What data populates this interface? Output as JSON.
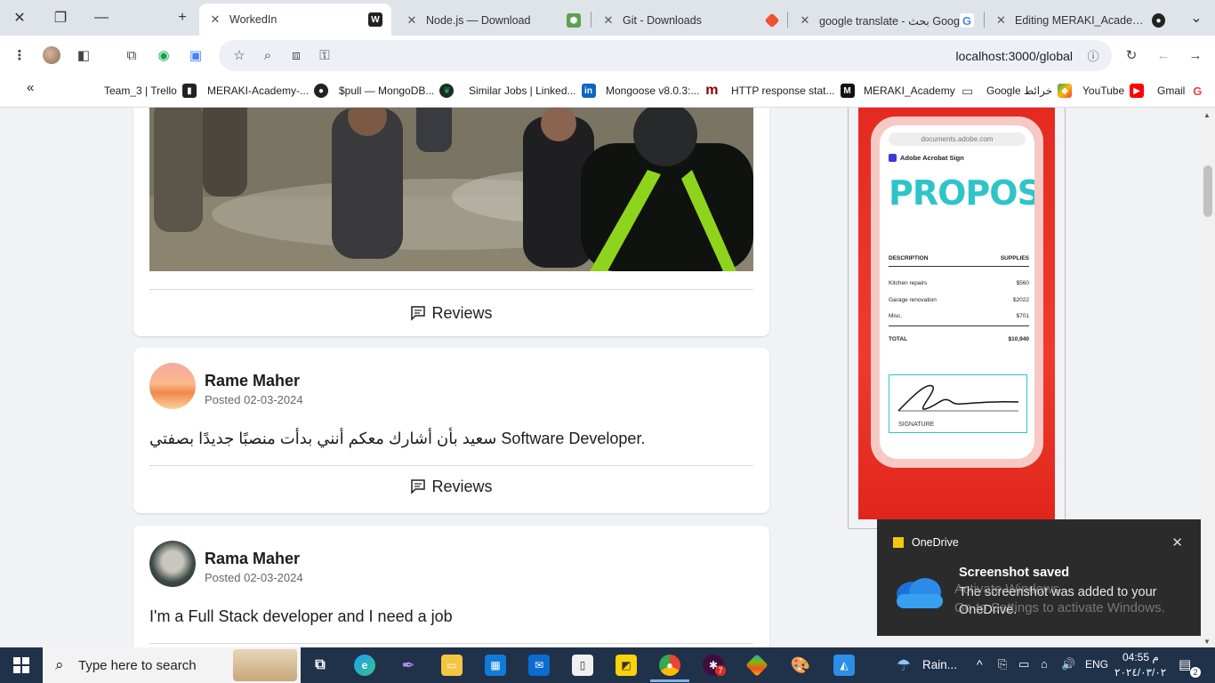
{
  "browser": {
    "tabs": [
      {
        "label": "WorkedIn",
        "active": true
      },
      {
        "label": "Node.js — Download",
        "active": false
      },
      {
        "label": "Git - Downloads",
        "active": false
      },
      {
        "label": "google translate - بحث Goog",
        "active": false
      },
      {
        "label": "Editing MERAKI_Academy_P",
        "active": false
      }
    ],
    "url": "localhost:3000/global",
    "bookmarks": [
      "Team_3 | Trello",
      "MERAKI-Academy-...",
      "$pull — MongoDB...",
      "Similar Jobs | Linked...",
      "Mongoose v8.0.3:...",
      "HTTP response stat...",
      "MERAKI_Academy",
      "Google خرائط",
      "YouTube",
      "Gmail"
    ]
  },
  "feed": {
    "reviews_label": "Reviews",
    "posts": [
      {
        "author": "Rame Maher",
        "posted": "Posted 02-03-2024",
        "content": "سعيد بأن أشارك معكم أنني بدأت منصبًا جديدًا بصفتي Software Developer."
      },
      {
        "author": "Rama Maher",
        "posted": "Posted 02-03-2024",
        "content": "I'm a Full Stack developer and I need a job"
      }
    ]
  },
  "ad": {
    "url": "documents.adobe.com",
    "app": "Adobe Acrobat Sign",
    "title": "PROPOSAL",
    "header": {
      "left": "DESCRIPTION",
      "right": "SUPPLIES"
    },
    "rows": [
      {
        "item": "Kitchen repairs",
        "amount": "$560"
      },
      {
        "item": "Garage renovation",
        "amount": "$2022"
      },
      {
        "item": "Misc.",
        "amount": "$701"
      }
    ],
    "total": {
      "label": "TOTAL",
      "amount": "$10,940"
    },
    "signature_label": "SIGNATURE"
  },
  "toast": {
    "app": "OneDrive",
    "title": "Screenshot saved",
    "body": "The screenshot was added to your OneDrive."
  },
  "watermark": {
    "line1": "Activate Windows",
    "line2": "Go to Settings to activate Windows."
  },
  "taskbar": {
    "search_placeholder": "Type here to search",
    "weather": "Rain...",
    "language": "ENG",
    "time": "04:55 م",
    "date": "٢٠٢٤/٠٣/٠٢",
    "notification_count": "2",
    "chat_badge": "7"
  }
}
